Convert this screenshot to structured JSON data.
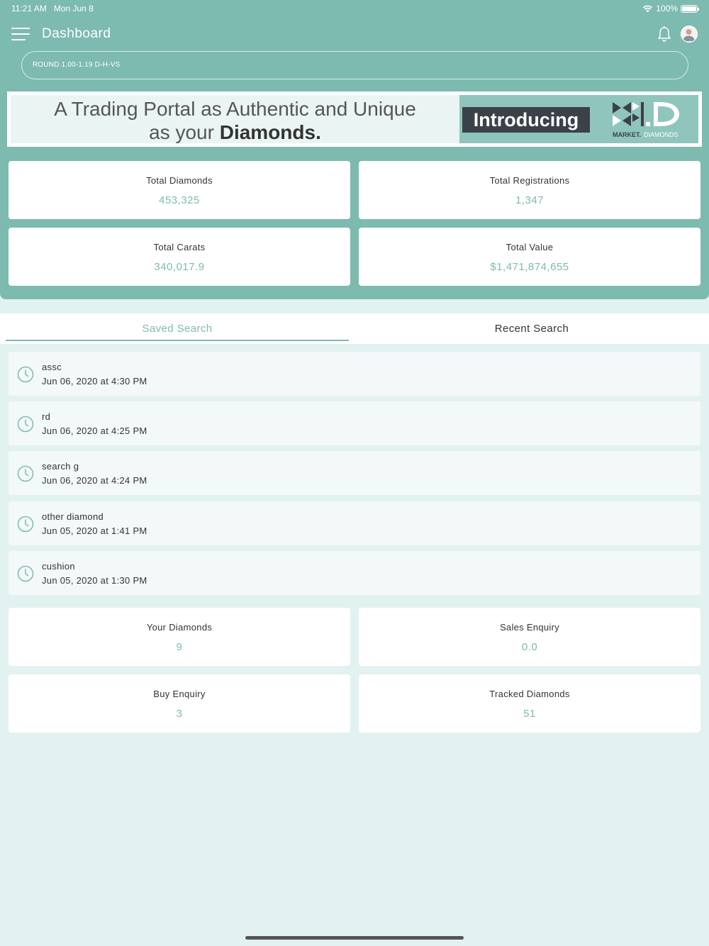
{
  "status_bar": {
    "time": "11:21 AM",
    "date": "Mon Jun 8",
    "battery": "100%"
  },
  "header": {
    "title": "Dashboard"
  },
  "search": {
    "query": "ROUND 1.00-1.19 D-H-VS"
  },
  "banner": {
    "line1": "A Trading Portal as Authentic and Unique",
    "line2_prefix": "as your ",
    "line2_bold": "Diamonds.",
    "intro": "Introducing",
    "logo_text_a": "MARKET.",
    "logo_text_b": "DIAMONDS"
  },
  "stats": [
    {
      "label": "Total Diamonds",
      "value": "453,325"
    },
    {
      "label": "Total Registrations",
      "value": "1,347"
    },
    {
      "label": "Total Carats",
      "value": "340,017.9"
    },
    {
      "label": "Total Value",
      "value": "$1,471,874,655"
    }
  ],
  "tabs": {
    "saved": "Saved Search",
    "recent": "Recent Search"
  },
  "saved_searches": [
    {
      "name": "assc",
      "date": "Jun 06, 2020 at 4:30 PM"
    },
    {
      "name": "rd",
      "date": "Jun 06, 2020 at 4:25 PM"
    },
    {
      "name": "search g",
      "date": "Jun 06, 2020 at 4:24 PM"
    },
    {
      "name": "other diamond",
      "date": "Jun 05, 2020 at 1:41 PM"
    },
    {
      "name": "cushion",
      "date": "Jun 05, 2020 at 1:30 PM"
    }
  ],
  "summary": [
    {
      "label": "Your Diamonds",
      "value": "9"
    },
    {
      "label": "Sales Enquiry",
      "value": "0.0"
    },
    {
      "label": "Buy Enquiry",
      "value": "3"
    },
    {
      "label": "Tracked Diamonds",
      "value": "51"
    }
  ],
  "colors": {
    "accent": "#7dbab0",
    "background": "#e2f2f0",
    "card": "#ffffff",
    "dark": "#3b4148"
  }
}
